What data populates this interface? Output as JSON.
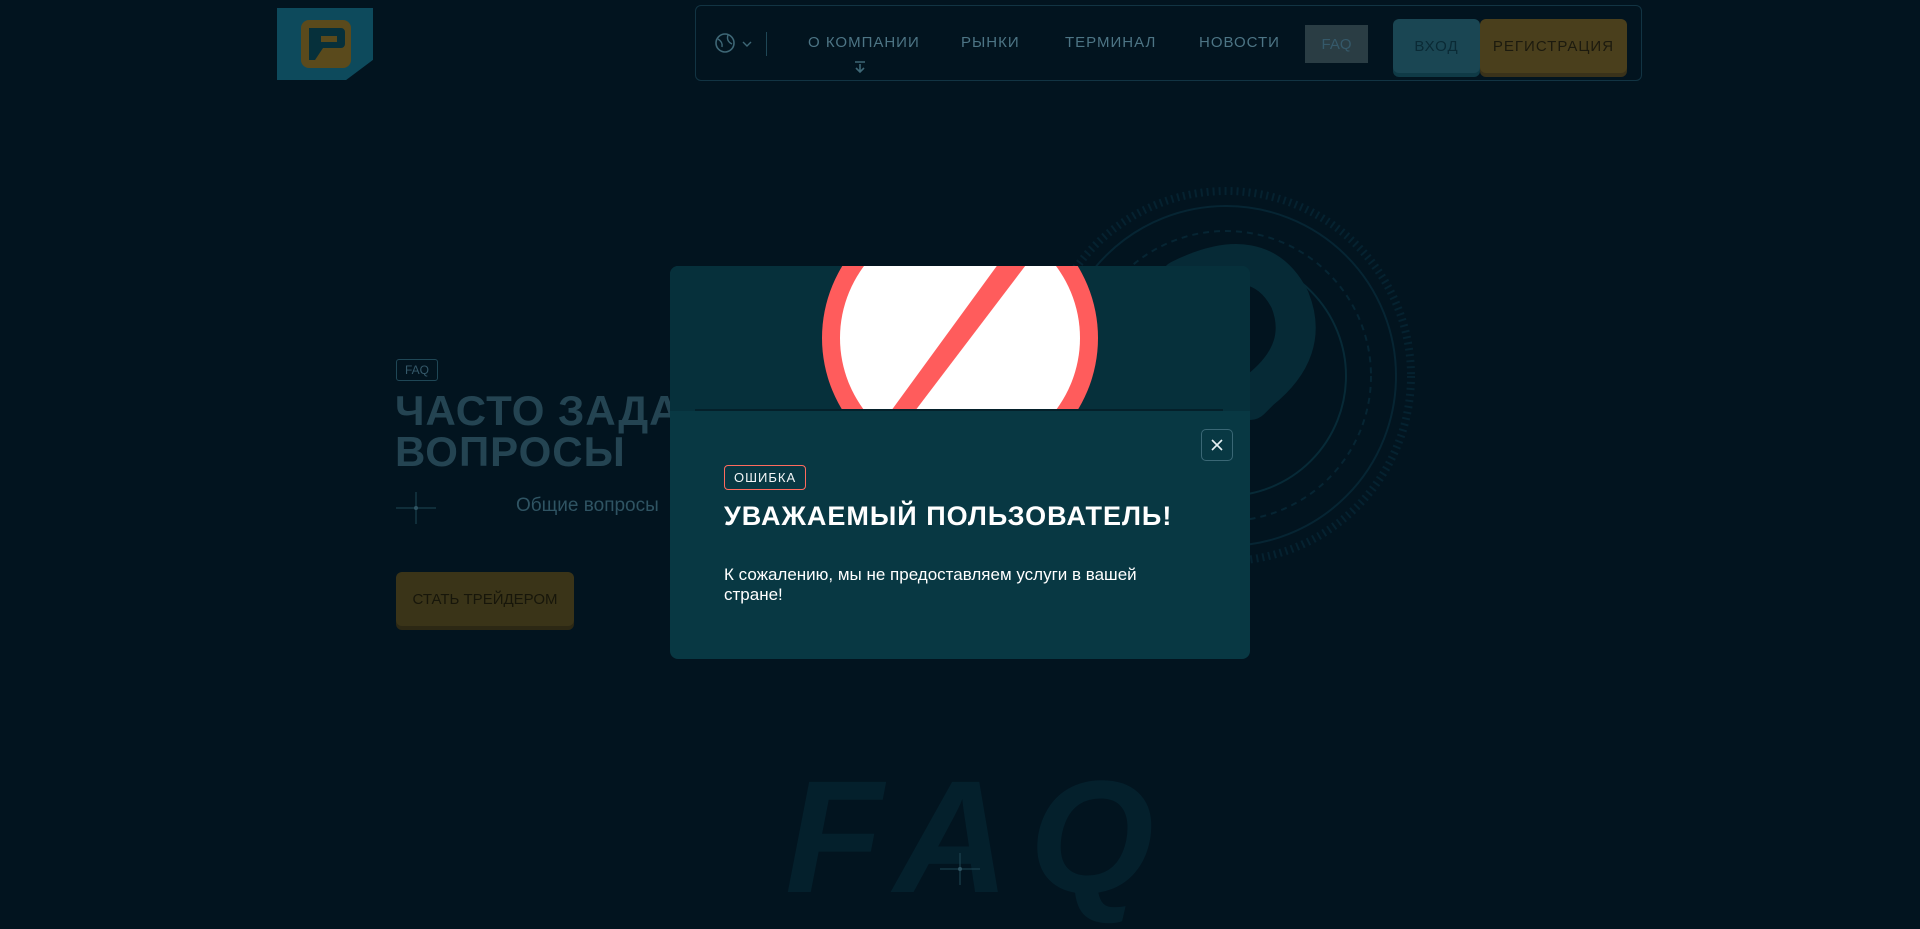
{
  "nav": {
    "items": [
      "О КОМПАНИИ",
      "РЫНКИ",
      "ТЕРМИНАЛ",
      "НОВОСТИ"
    ],
    "faq": "FAQ",
    "login": "ВХОД",
    "register": "РЕГИСТРАЦИЯ"
  },
  "hero": {
    "tag": "FAQ",
    "title_line1": "ЧАСТО ЗАДАВ",
    "title_line2": "ВОПРОСЫ",
    "subtitle": "Общие вопросы",
    "cta": "СТАТЬ ТРЕЙДЕРОМ"
  },
  "background_text": "FAQ",
  "modal": {
    "badge": "ОШИБКА",
    "title": "УВАЖАЕМЫЙ ПОЛЬЗОВАТЕЛЬ!",
    "message": "К сожалению, мы не предоставляем услуги в вашей стране!"
  },
  "colors": {
    "background": "#02141f",
    "modal": "#083843",
    "ban_red": "#ff5c5c",
    "badge_border": "#ff6b5e"
  },
  "icons": [
    "logo-icon",
    "globe-icon",
    "chevron-down-icon",
    "arrow-down-icon",
    "ban-icon",
    "close-icon",
    "crosshair-icon"
  ]
}
